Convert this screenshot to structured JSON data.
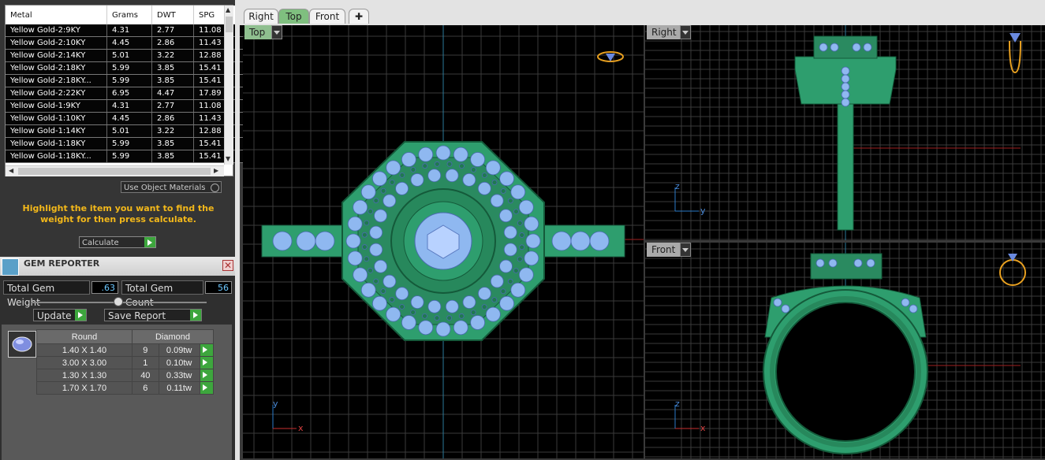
{
  "metal_table": {
    "columns": [
      "Metal",
      "Grams",
      "DWT",
      "SPG"
    ],
    "rows": [
      [
        "Yellow Gold-2:9KY",
        "4.31",
        "2.77",
        "11.08"
      ],
      [
        "Yellow Gold-2:10KY",
        "4.45",
        "2.86",
        "11.43"
      ],
      [
        "Yellow Gold-2:14KY",
        "5.01",
        "3.22",
        "12.88"
      ],
      [
        "Yellow Gold-2:18KY",
        "5.99",
        "3.85",
        "15.41"
      ],
      [
        "Yellow Gold-2:18KY...",
        "5.99",
        "3.85",
        "15.41"
      ],
      [
        "Yellow Gold-2:22KY",
        "6.95",
        "4.47",
        "17.89"
      ],
      [
        "Yellow Gold-1:9KY",
        "4.31",
        "2.77",
        "11.08"
      ],
      [
        "Yellow Gold-1:10KY",
        "4.45",
        "2.86",
        "11.43"
      ],
      [
        "Yellow Gold-1:14KY",
        "5.01",
        "3.22",
        "12.88"
      ],
      [
        "Yellow Gold-1:18KY",
        "5.99",
        "3.85",
        "15.41"
      ],
      [
        "Yellow Gold-1:18KY...",
        "5.99",
        "3.85",
        "15.41"
      ]
    ]
  },
  "use_object_materials": "Use Object Materials",
  "hint": "Highlight the item you want to find the weight for then press calculate.",
  "calculate_label": "Calculate",
  "gem_reporter": {
    "title": "GEM REPORTER",
    "total_weight_label": "Total Gem Weight",
    "total_weight_value": ".63",
    "total_count_label": "Total Gem Count",
    "total_count_value": "56",
    "update_label": "Update",
    "save_report_label": "Save Report",
    "table_header": [
      "Round",
      "Diamond"
    ],
    "rows": [
      [
        "1.40 X 1.40",
        "9",
        "0.09tw"
      ],
      [
        "3.00 X 3.00",
        "1",
        "0.10tw"
      ],
      [
        "1.30 X 1.30",
        "40",
        "0.33tw"
      ],
      [
        "1.70 X 1.70",
        "6",
        "0.11tw"
      ]
    ]
  },
  "tabs": [
    "Right",
    "Top",
    "Front"
  ],
  "active_tab": "Top",
  "viewports": {
    "top": {
      "label": "Top",
      "axis_y": "y",
      "axis_x": "x"
    },
    "right": {
      "label": "Right",
      "axis_z": "z",
      "axis_y": "y"
    },
    "front": {
      "label": "Front",
      "axis_z": "z",
      "axis_x": "x"
    }
  },
  "colors": {
    "metal": "#2e9e6e",
    "gem": "#8fb8f0",
    "grid": "#3a3a3a",
    "hint": "#f3b81a",
    "button_green": "#3da63d"
  }
}
